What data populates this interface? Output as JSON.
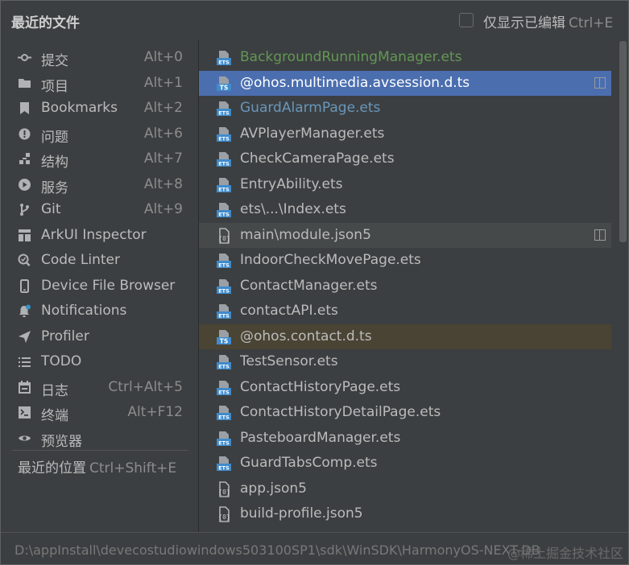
{
  "header": {
    "title": "最近的文件",
    "checkbox_label": "仅显示已编辑",
    "checkbox_shortcut": "Ctrl+E",
    "checkbox_checked": false
  },
  "left_menu": [
    {
      "label": "提交",
      "shortcut": "Alt+0",
      "icon": "commit-icon"
    },
    {
      "label": "项目",
      "shortcut": "Alt+1",
      "icon": "folder-icon"
    },
    {
      "label": "Bookmarks",
      "shortcut": "Alt+2",
      "icon": "bookmark-icon"
    },
    {
      "label": "问题",
      "shortcut": "Alt+6",
      "icon": "problems-icon"
    },
    {
      "label": "结构",
      "shortcut": "Alt+7",
      "icon": "structure-icon"
    },
    {
      "label": "服务",
      "shortcut": "Alt+8",
      "icon": "services-icon"
    },
    {
      "label": "Git",
      "shortcut": "Alt+9",
      "icon": "git-branch-icon"
    },
    {
      "label": "ArkUI Inspector",
      "shortcut": "",
      "icon": "inspector-icon"
    },
    {
      "label": "Code Linter",
      "shortcut": "",
      "icon": "code-linter-icon"
    },
    {
      "label": "Device File Browser",
      "shortcut": "",
      "icon": "device-icon"
    },
    {
      "label": "Notifications",
      "shortcut": "",
      "icon": "bell-icon"
    },
    {
      "label": "Profiler",
      "shortcut": "",
      "icon": "profiler-icon"
    },
    {
      "label": "TODO",
      "shortcut": "",
      "icon": "todo-list-icon"
    },
    {
      "label": "日志",
      "shortcut": "Ctrl+Alt+5",
      "icon": "log-icon"
    },
    {
      "label": "终端",
      "shortcut": "Alt+F12",
      "icon": "terminal-icon"
    },
    {
      "label": "预览器",
      "shortcut": "",
      "icon": "eye-icon"
    }
  ],
  "recent_locations": {
    "label": "最近的位置",
    "shortcut": "Ctrl+Shift+E"
  },
  "files": [
    {
      "name": "BackgroundRunningManager.ets",
      "type": "ETS",
      "color": "green",
      "state": ""
    },
    {
      "name": "@ohos.multimedia.avsession.d.ts",
      "type": "TS",
      "color": "",
      "state": "sel"
    },
    {
      "name": "GuardAlarmPage.ets",
      "type": "ETS",
      "color": "blue",
      "state": ""
    },
    {
      "name": "AVPlayerManager.ets",
      "type": "ETS",
      "color": "",
      "state": ""
    },
    {
      "name": "CheckCameraPage.ets",
      "type": "ETS",
      "color": "",
      "state": ""
    },
    {
      "name": "EntryAbility.ets",
      "type": "ETS",
      "color": "",
      "state": ""
    },
    {
      "name": "ets\\...\\Index.ets",
      "type": "ETS",
      "color": "",
      "state": ""
    },
    {
      "name": "main\\module.json5",
      "type": "JSON",
      "color": "",
      "state": "hov"
    },
    {
      "name": "IndoorCheckMovePage.ets",
      "type": "ETS",
      "color": "",
      "state": ""
    },
    {
      "name": "ContactManager.ets",
      "type": "ETS",
      "color": "",
      "state": ""
    },
    {
      "name": "contactAPI.ets",
      "type": "ETS",
      "color": "",
      "state": ""
    },
    {
      "name": "@ohos.contact.d.ts",
      "type": "TS",
      "color": "",
      "state": "mod"
    },
    {
      "name": "TestSensor.ets",
      "type": "ETS",
      "color": "",
      "state": ""
    },
    {
      "name": "ContactHistoryPage.ets",
      "type": "ETS",
      "color": "",
      "state": ""
    },
    {
      "name": "ContactHistoryDetailPage.ets",
      "type": "ETS",
      "color": "",
      "state": ""
    },
    {
      "name": "PasteboardManager.ets",
      "type": "ETS",
      "color": "",
      "state": ""
    },
    {
      "name": "GuardTabsComp.ets",
      "type": "ETS",
      "color": "",
      "state": ""
    },
    {
      "name": "app.json5",
      "type": "JSON",
      "color": "",
      "state": ""
    },
    {
      "name": "build-profile.json5",
      "type": "JSON",
      "color": "",
      "state": ""
    }
  ],
  "footer": {
    "path": "D:\\appInstall\\devecostudiowindows503100SP1\\sdk\\WinSDK\\HarmonyOS-NEXT-DB",
    "watermark": "@稀土掘金技术社区"
  },
  "colors": {
    "background": "#3c3f41",
    "selection": "#4b6eaf",
    "ets_icon": "#3f8bcc",
    "green_text": "#629755",
    "blue_text": "#6897bb"
  }
}
